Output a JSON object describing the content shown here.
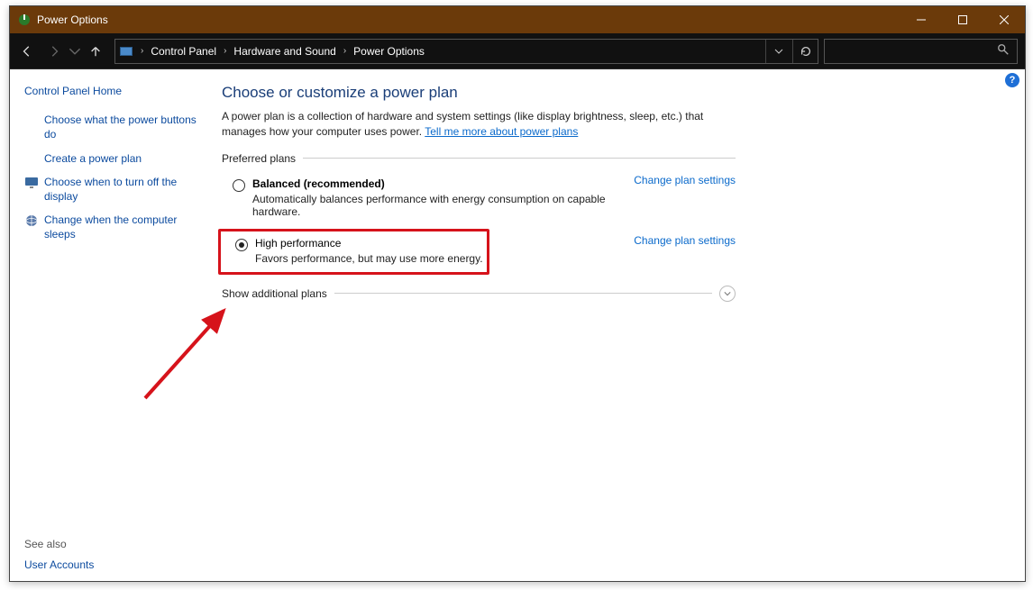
{
  "window_title": "Power Options",
  "breadcrumb": [
    "Control Panel",
    "Hardware and Sound",
    "Power Options"
  ],
  "help_tooltip": "?",
  "sidebar": {
    "home": "Control Panel Home",
    "items": [
      {
        "label": "Choose what the power buttons do",
        "icon": null
      },
      {
        "label": "Create a power plan",
        "icon": null
      },
      {
        "label": "Choose when to turn off the display",
        "icon": "monitor"
      },
      {
        "label": "Change when the computer sleeps",
        "icon": "globe"
      }
    ],
    "see_also_label": "See also",
    "see_also_items": [
      "User Accounts"
    ]
  },
  "main": {
    "heading": "Choose or customize a power plan",
    "description": "A power plan is a collection of hardware and system settings (like display brightness, sleep, etc.) that manages how your computer uses power. ",
    "description_link": "Tell me more about power plans",
    "preferred_label": "Preferred plans",
    "plans": [
      {
        "title": "Balanced (recommended)",
        "subtitle": "Automatically balances performance with energy consumption on capable hardware.",
        "selected": false,
        "bold": true,
        "link": "Change plan settings"
      },
      {
        "title": "High performance",
        "subtitle": "Favors performance, but may use more energy.",
        "selected": true,
        "bold": false,
        "link": "Change plan settings"
      }
    ],
    "show_additional": "Show additional plans"
  }
}
